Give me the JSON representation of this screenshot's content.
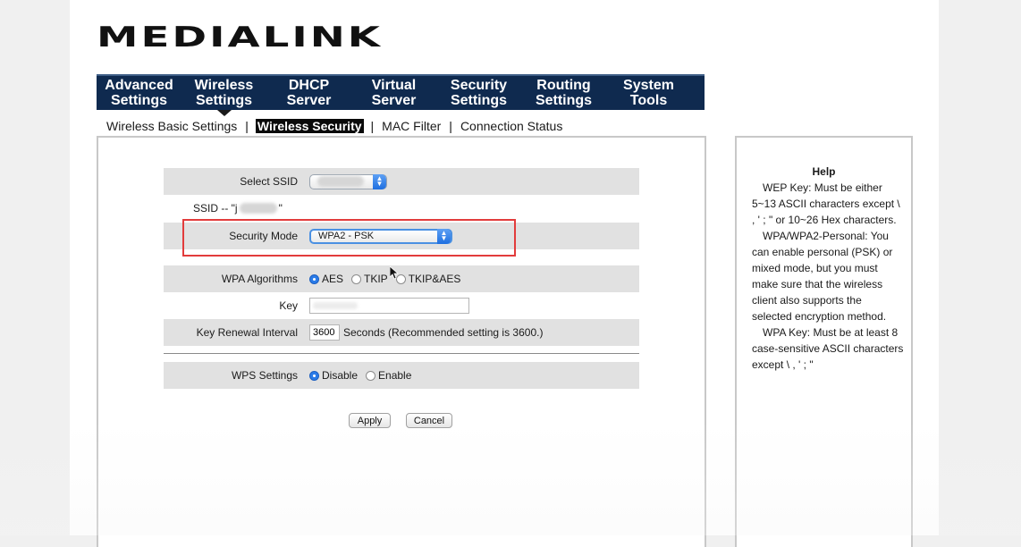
{
  "brand": {
    "logo_text": "MEDIALINK"
  },
  "top_nav": [
    {
      "line1": "Advanced",
      "line2": "Settings",
      "active": false
    },
    {
      "line1": "Wireless",
      "line2": "Settings",
      "active": true
    },
    {
      "line1": "DHCP",
      "line2": "Server",
      "active": false
    },
    {
      "line1": "Virtual",
      "line2": "Server",
      "active": false
    },
    {
      "line1": "Security",
      "line2": "Settings",
      "active": false
    },
    {
      "line1": "Routing",
      "line2": "Settings",
      "active": false
    },
    {
      "line1": "System",
      "line2": "Tools",
      "active": false
    }
  ],
  "sub_nav": {
    "items": [
      "Wireless Basic Settings",
      "Wireless Security",
      "MAC Filter",
      "Connection Status"
    ],
    "active": "Wireless Security",
    "separator": "|"
  },
  "form": {
    "select_ssid_label": "Select SSID",
    "ssid_line_prefix": "SSID -- \"j",
    "ssid_line_suffix": "\"",
    "security_mode_label": "Security Mode",
    "security_mode_value": "WPA2 - PSK",
    "wpa_algorithms_label": "WPA Algorithms",
    "wpa_options": [
      "AES",
      "TKIP",
      "TKIP&AES"
    ],
    "wpa_selected": "AES",
    "key_label": "Key",
    "key_renewal_label": "Key Renewal Interval",
    "key_renewal_value": "3600",
    "key_renewal_suffix": "Seconds (Recommended setting is 3600.)",
    "wps_label": "WPS Settings",
    "wps_options": [
      "Disable",
      "Enable"
    ],
    "wps_selected": "Disable",
    "apply_label": "Apply",
    "cancel_label": "Cancel"
  },
  "help": {
    "title": "Help",
    "paragraphs": [
      "WEP Key: Must be either 5~13 ASCII characters except \\ , ' ; \" or 10~26 Hex characters.",
      "WPA/WPA2-Personal: You can enable personal (PSK) or mixed mode, but you must make sure that the wireless client also supports the selected encryption method.",
      "WPA Key: Must be at least 8 case-sensitive ASCII characters except \\ , ' ; \""
    ]
  },
  "colors": {
    "nav_background": "#0f2a4f",
    "highlight_border": "#e23c3c",
    "radio_selected": "#2a7be8"
  }
}
